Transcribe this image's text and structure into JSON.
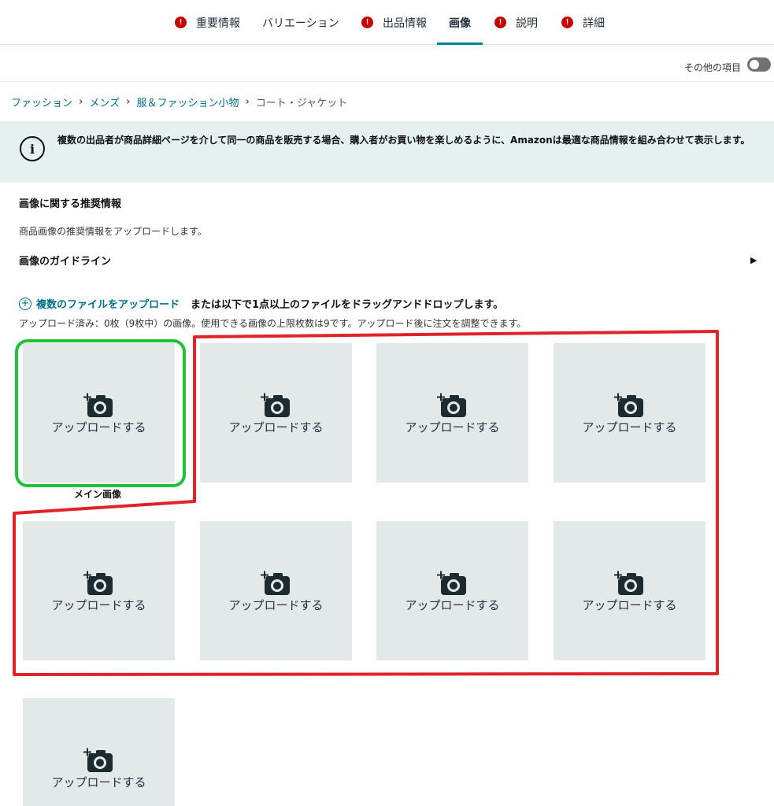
{
  "tabs": [
    {
      "label": "重要情報",
      "alert": true,
      "active": false
    },
    {
      "label": "バリエーション",
      "alert": false,
      "active": false
    },
    {
      "label": "出品情報",
      "alert": true,
      "active": false
    },
    {
      "label": "画像",
      "alert": false,
      "active": true
    },
    {
      "label": "説明",
      "alert": true,
      "active": false
    },
    {
      "label": "詳細",
      "alert": true,
      "active": false
    }
  ],
  "alert_glyph": "!",
  "toolbar": {
    "toggle_label": "その他の項目",
    "toggle_on": false
  },
  "breadcrumb": [
    "ファッション",
    "メンズ",
    "服＆ファッション小物",
    "コート・ジャケット"
  ],
  "breadcrumb_sep": "›",
  "info": {
    "icon_glyph": "i",
    "text": "複数の出品者が商品詳細ページを介して同一の商品を販売する場合、購入者がお買い物を楽しめるように、Amazonは最適な商品情報を組み合わせて表示します。"
  },
  "recommend": {
    "title": "画像に関する推奨情報",
    "description": "商品画像の推奨情報をアップロードします。",
    "guideline": "画像のガイドライン",
    "guideline_arrow": "▶"
  },
  "upload": {
    "plus_glyph": "+",
    "link_label": "複数のファイルをアップロード",
    "rest_text": "または以下で1点以上のファイルをドラッグアンドドロップします。",
    "count_text": "アップロード済み：0枚（9枚中）の画像。使用できる画像の上限枚数は9です。アップロード後に注文を調整できます。"
  },
  "slots": [
    {
      "label": "アップロードする"
    },
    {
      "label": "アップロードする"
    },
    {
      "label": "アップロードする"
    },
    {
      "label": "アップロードする"
    },
    {
      "label": "アップロードする"
    },
    {
      "label": "アップロードする"
    },
    {
      "label": "アップロードする"
    },
    {
      "label": "アップロードする"
    },
    {
      "label": "アップロードする"
    }
  ],
  "main_image_caption": "メイン画像",
  "colors": {
    "accent": "#008296",
    "link": "#007185",
    "alert": "#c40000",
    "slot_bg": "#e3e9e9",
    "info_bg": "#e5f0f1",
    "annotation_green": "#22c13a",
    "annotation_red": "#e0222a"
  },
  "icons": {
    "tab_alert": "alert-icon",
    "info": "info-icon",
    "upload": "plus-circle-icon",
    "slot": "add-camera-icon"
  }
}
